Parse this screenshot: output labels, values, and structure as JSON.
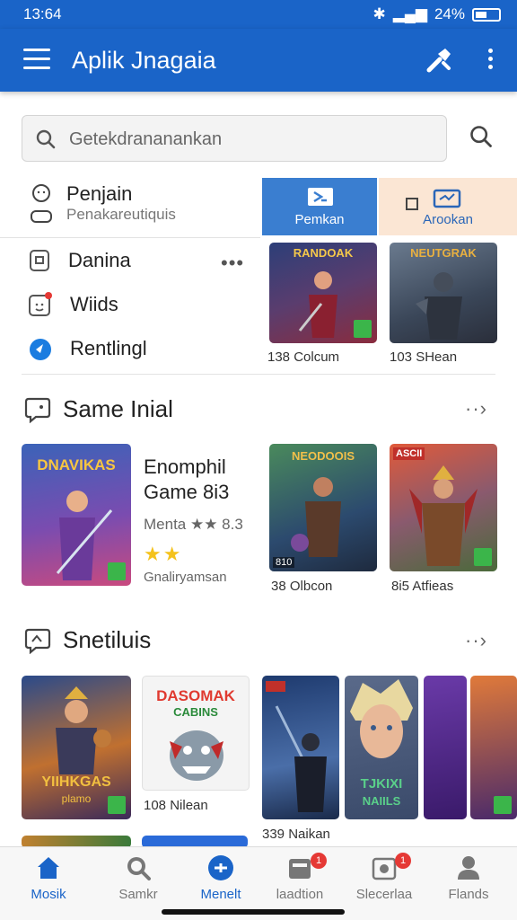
{
  "status": {
    "time": "13:64",
    "battery": "24%"
  },
  "app_bar": {
    "title": "Aplik Jnagaia"
  },
  "search": {
    "placeholder": "Getekdrananankan"
  },
  "menu": {
    "items": [
      {
        "label": "Penjain",
        "sub": "Penakareutiquis"
      },
      {
        "label": "Danina"
      },
      {
        "label": "Wiids"
      },
      {
        "label": "Rentlingl"
      }
    ]
  },
  "tabs": [
    {
      "label": "Pemkan"
    },
    {
      "label": "Arookan"
    }
  ],
  "top_grid": [
    {
      "caption": "138 Colcum",
      "art_title": "RANDOAK"
    },
    {
      "caption": "103 SHean",
      "art_title": "NEUTGRAK"
    }
  ],
  "section1": {
    "title": "Same Inial",
    "featured": {
      "art_title": "DNAVIKAS",
      "title_line1": "Enomphil",
      "title_line2": "Game 8i3",
      "meta": "Menta ★★ 8.3",
      "stars": "★★",
      "sub": "Gnaliryamsan"
    },
    "cards": [
      {
        "caption": "38 Olbcon",
        "art_title": "NEODOOIS",
        "tag": "810"
      },
      {
        "caption": "8i5 Atfieas",
        "art_title": "ASCII"
      }
    ]
  },
  "section2": {
    "title": "Snetiluis",
    "cards": [
      {
        "art_title": "YIIHKGAS",
        "sub_art": "plamo"
      },
      {
        "caption": "108 Nilean",
        "art_title": "DASOMAK",
        "sub_art": "CABINS"
      },
      {
        "caption": "339 Naikan"
      },
      {
        "art_title": "TJKIXI",
        "sub_art": "NAIILS"
      }
    ]
  },
  "bottom_nav": [
    {
      "label": "Mosik",
      "active": true
    },
    {
      "label": "Samkr"
    },
    {
      "label": "Menelt",
      "active": true
    },
    {
      "label": "laadtion",
      "badge": "1"
    },
    {
      "label": "Slecerlaa",
      "badge": "1"
    },
    {
      "label": "Flands"
    }
  ],
  "colors": {
    "primary": "#1a64c8",
    "tab_blue": "#3a7ed0",
    "tab_peach": "#fbe6d4",
    "star": "#f4c21d",
    "badge": "#e53935"
  }
}
